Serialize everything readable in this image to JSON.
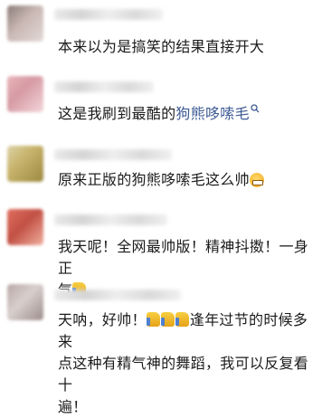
{
  "comments": [
    {
      "text": "本来以为是搞笑的结果直接开大",
      "avatar_colors": [
        "#8b7c78",
        "#c9b8b4",
        "#e2d9d6"
      ]
    },
    {
      "text_before": "这是我刷到最酷的",
      "link": "狗熊哆嗦毛",
      "avatar_colors": [
        "#e8b6bb",
        "#d69aa3",
        "#f3d6d9"
      ]
    },
    {
      "text": "原来正版的狗熊哆嗦毛这么帅",
      "emoji": "grinning-face",
      "avatar_colors": [
        "#c7b36b",
        "#9c8840",
        "#ddd3a8"
      ]
    },
    {
      "line1": "我天呢！全网最帅版！精神抖擞！一身正",
      "line2": "气",
      "emoji": "thumbs-up",
      "avatar_colors": [
        "#e07060",
        "#c25044",
        "#f0b0a0"
      ]
    },
    {
      "line1_before": "天呐，好帅！",
      "line1_after": "逢年过节的时候多来",
      "line2": "点这种有精气神的舞蹈，我可以反复看十",
      "line3": "遍！",
      "emoji": "thumbs-up",
      "avatar_colors": [
        "#b8a8a6",
        "#d8cfcd",
        "#9c8c8a"
      ]
    }
  ]
}
